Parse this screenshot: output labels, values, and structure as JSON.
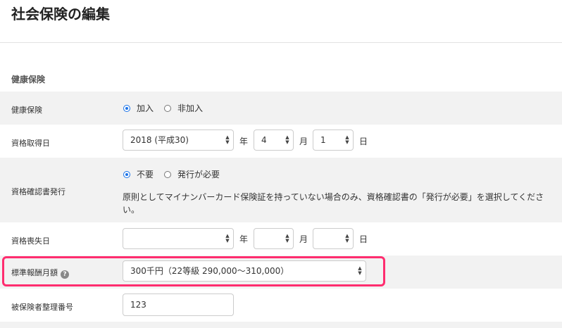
{
  "page": {
    "title": "社会保険の編集"
  },
  "section": {
    "title": "健康保険"
  },
  "health_insurance": {
    "label": "健康保険",
    "options": [
      "加入",
      "非加入"
    ],
    "selected": "加入"
  },
  "acquisition_date": {
    "label": "資格取得日",
    "year": "2018 (平成30)",
    "year_unit": "年",
    "month": "4",
    "month_unit": "月",
    "day": "1",
    "day_unit": "日"
  },
  "certificate_issue": {
    "label": "資格確認書発行",
    "options": [
      "不要",
      "発行が必要"
    ],
    "selected": "不要",
    "note": "原則としてマイナンバーカード保険証を持っていない場合のみ、資格確認書の「発行が必要」を選択してください。"
  },
  "loss_date": {
    "label": "資格喪失日",
    "year": "",
    "year_unit": "年",
    "month": "",
    "month_unit": "月",
    "day": "",
    "day_unit": "日"
  },
  "standard_monthly": {
    "label": "標準報酬月額",
    "help_icon": "question-circle-icon",
    "value": "300千円（22等級 290,000〜310,000）"
  },
  "insured_number": {
    "label": "被保険者整理番号",
    "value": "123"
  },
  "colors": {
    "highlight": "#ff2d6f",
    "radio_checked": "#1a73e8",
    "row_shade": "#f2f2f2"
  }
}
